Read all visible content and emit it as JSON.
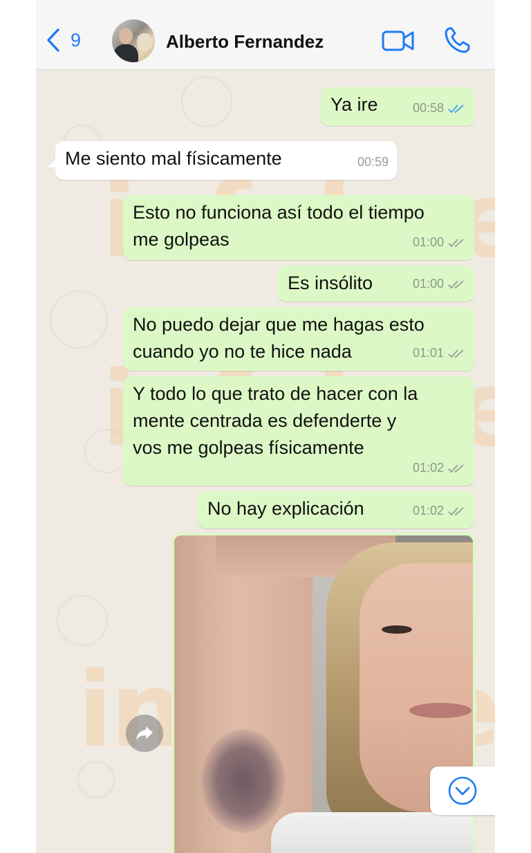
{
  "header": {
    "back_count": "9",
    "contact_name": "Alberto Fernandez",
    "accent_color": "#1f7bf2",
    "icons": [
      "chevron-left-icon",
      "video-call-icon",
      "phone-icon"
    ]
  },
  "messages": [
    {
      "direction": "out",
      "text": "Ya ire",
      "time": "00:58",
      "status": "read"
    },
    {
      "direction": "in",
      "text": "Me siento mal físicamente",
      "time": "00:59"
    },
    {
      "direction": "out",
      "text": "Esto no funciona así todo el tiempo\nme golpeas",
      "time": "01:00",
      "status": "delivered"
    },
    {
      "direction": "out",
      "text": "Es insólito",
      "time": "01:00",
      "status": "delivered"
    },
    {
      "direction": "out",
      "text": "No puedo dejar que me hagas esto\ncuando yo no te hice nada",
      "time": "01:01",
      "status": "delivered"
    },
    {
      "direction": "out",
      "text": "Y todo lo que trato de hacer con la\nmente centrada es defenderte y\nvos me golpeas físicamente",
      "time": "01:02",
      "status": "delivered"
    },
    {
      "direction": "out",
      "text": "No hay explicación",
      "time": "01:02",
      "status": "delivered"
    }
  ],
  "photo_message": {
    "direction": "out",
    "content": "photo"
  },
  "watermark_text": "infobae",
  "colors": {
    "outgoing_bubble": "#dcf8c6",
    "incoming_bubble": "#ffffff",
    "chat_background": "#efeae2",
    "read_ticks": "#4fa8e8",
    "delivered_ticks": "#9aa69a"
  }
}
